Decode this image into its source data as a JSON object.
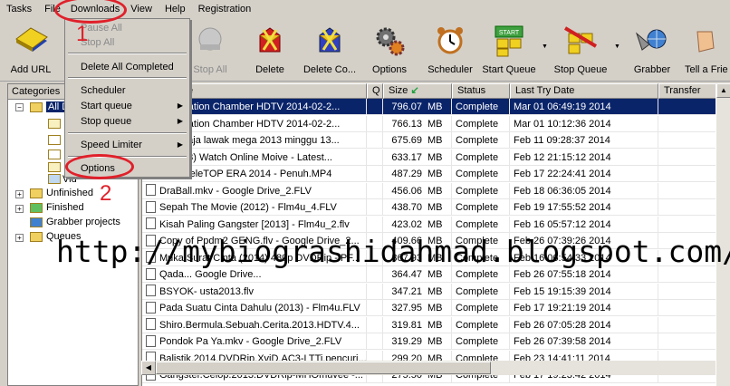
{
  "menubar": [
    "Tasks",
    "File",
    "Downloads",
    "View",
    "Help",
    "Registration"
  ],
  "toolbar": {
    "add_url": "Add URL",
    "stop_all": "Stop All",
    "delete": "Delete",
    "delete_completed": "Delete Co...",
    "options": "Options",
    "scheduler": "Scheduler",
    "start_queue": "Start Queue",
    "stop_queue": "Stop Queue",
    "grabber": "Grabber",
    "tell_friend": "Tell a Frie",
    "start_badge": "START"
  },
  "downloads_menu": {
    "pause_all": "Pause All",
    "stop_all": "Stop All",
    "delete_all_completed": "Delete All Completed",
    "scheduler": "Scheduler",
    "start_queue": "Start queue",
    "stop_queue": "Stop queue",
    "speed_limiter": "Speed Limiter",
    "options": "Options"
  },
  "categories": {
    "header": "Categories",
    "all": "All D",
    "video": "Vid",
    "unfinished": "Unfinished",
    "finished": "Finished",
    "grabber_projects": "Grabber projects",
    "queues": "Queues"
  },
  "columns": {
    "file": "File Name",
    "q": "Q",
    "size": "Size",
    "status": "Status",
    "last_try": "Last Try Date",
    "transfer": "Transfer"
  },
  "rows": [
    {
      "name": "...limination Chamber HDTV 2014-02-2...",
      "size": "796.07",
      "unit": "MB",
      "status": "Complete",
      "date": "Mar 01 06:49:19 2014"
    },
    {
      "name": "...limination Chamber HDTV 2014-02-2...",
      "size": "766.13",
      "unit": "MB",
      "status": "Complete",
      "date": "Mar 01 10:12:36 2014"
    },
    {
      "name": "...aharaja lawak mega 2013 minggu 13...",
      "size": "675.69",
      "unit": "MB",
      "status": "Complete",
      "date": "Feb 11 09:28:37 2014"
    },
    {
      "name": "...(2013) Watch Online Moive - Latest...",
      "size": "633.17",
      "unit": "MB",
      "status": "Complete",
      "date": "Feb 12 21:15:12 2014"
    },
    {
      "name": "...ah MeleTOP ERA 2014 - Penuh.MP4",
      "size": "487.29",
      "unit": "MB",
      "status": "Complete",
      "date": "Feb 17 22:24:41 2014"
    },
    {
      "name": "DraBall.mkv - Google Drive_2.FLV",
      "size": "456.06",
      "unit": "MB",
      "status": "Complete",
      "date": "Feb 18 06:36:05 2014"
    },
    {
      "name": "Sepah The Movie (2012) - Flm4u_4.FLV",
      "size": "438.70",
      "unit": "MB",
      "status": "Complete",
      "date": "Feb 19 17:55:52 2014"
    },
    {
      "name": "Kisah Paling Gangster [2013] - Flm4u_2.flv",
      "size": "423.02",
      "unit": "MB",
      "status": "Complete",
      "date": "Feb 16 05:57:12 2014"
    },
    {
      "name": "Copy of Ppdm2 GENG.flv - Google Drive_2...",
      "size": "409.66",
      "unit": "MB",
      "status": "Complete",
      "date": "Feb 26 07:39:26 2014"
    },
    {
      "name": "Muka Surat Cinta (2014) 480p DVDRip - PF...",
      "size": "367.93",
      "unit": "MB",
      "status": "Complete",
      "date": "Feb 16 06:54:33 2014"
    },
    {
      "name": "Qada... Google Drive...",
      "size": "364.47",
      "unit": "MB",
      "status": "Complete",
      "date": "Feb 26 07:55:18 2014"
    },
    {
      "name": "BSYOK- usta2013.flv",
      "size": "347.21",
      "unit": "MB",
      "status": "Complete",
      "date": "Feb 15 19:15:39 2014"
    },
    {
      "name": "Pada Suatu Cinta Dahulu (2013) - Flm4u.FLV",
      "size": "327.95",
      "unit": "MB",
      "status": "Complete",
      "date": "Feb 17 19:21:19 2014"
    },
    {
      "name": "Shiro.Bermula.Sebuah.Cerita.2013.HDTV.4...",
      "size": "319.81",
      "unit": "MB",
      "status": "Complete",
      "date": "Feb 26 07:05:28 2014"
    },
    {
      "name": "Pondok Pa Ya.mkv - Google Drive_2.FLV",
      "size": "319.29",
      "unit": "MB",
      "status": "Complete",
      "date": "Feb 26 07:39:58 2014"
    },
    {
      "name": "Balistik.2014.DVDRip.XviD.AC3-LTTi.pencuri...",
      "size": "299.20",
      "unit": "MB",
      "status": "Complete",
      "date": "Feb 23 14:41:11 2014"
    },
    {
      "name": "Gangster.Celop.2013.DVDRip-MHOmuvee -...",
      "size": "275.50",
      "unit": "MB",
      "status": "Complete",
      "date": "Feb 17 19:23:42 2014"
    }
  ],
  "annotations": {
    "one": "1",
    "two": "2"
  },
  "watermark": "http://mybiograshidahmad.blogspot.com/"
}
